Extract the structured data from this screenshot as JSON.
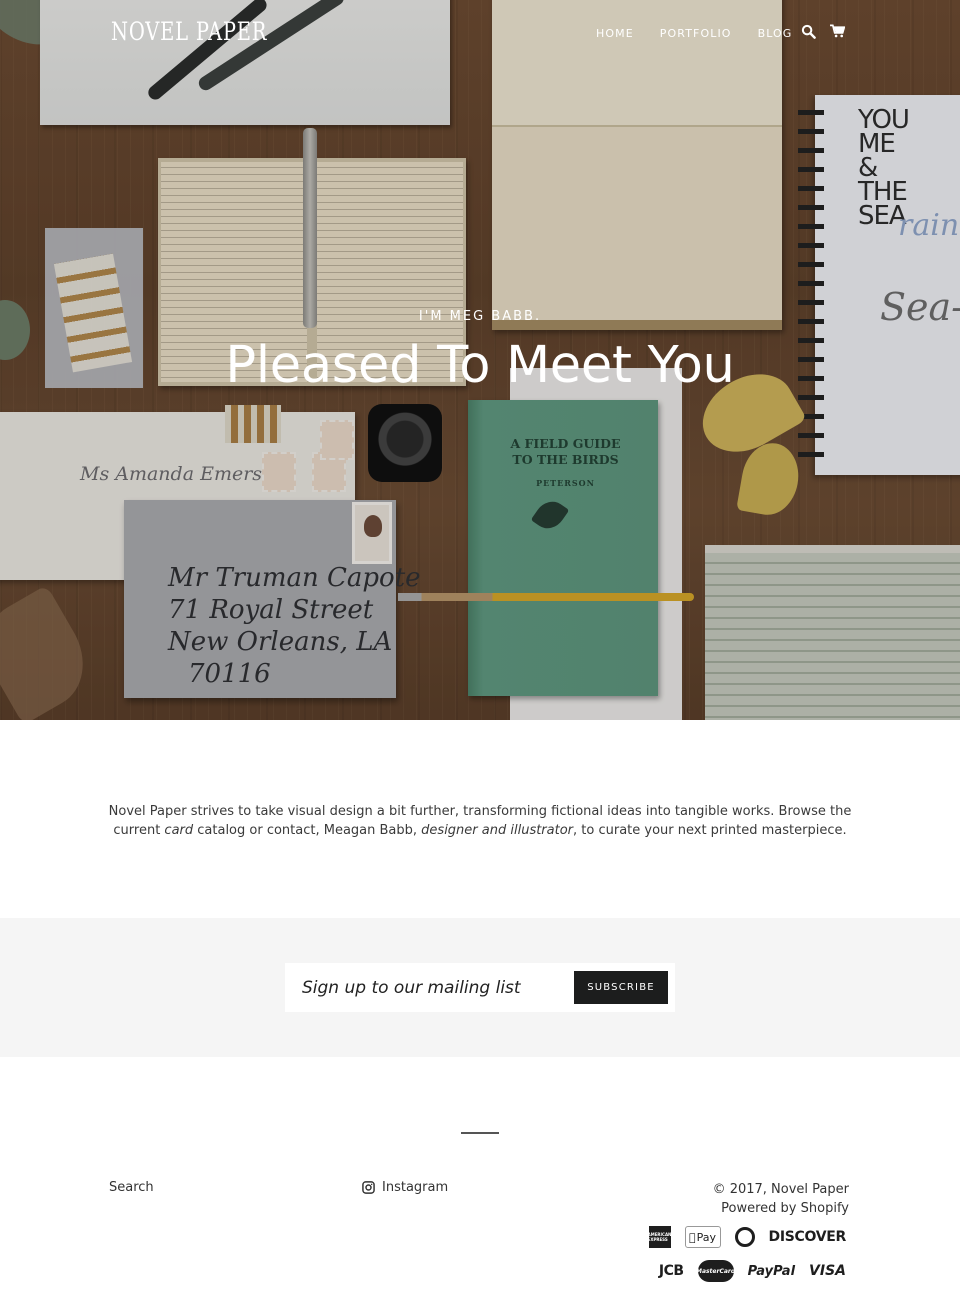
{
  "header": {
    "logo": "NOVEL PAPER",
    "nav": [
      {
        "label": "HOME"
      },
      {
        "label": "PORTFOLIO"
      },
      {
        "label": "BLOG"
      }
    ],
    "icons": [
      "search-icon",
      "cart-icon"
    ]
  },
  "hero": {
    "subtitle": "I'M MEG BABB.",
    "title": "Pleased To Meet You",
    "photo_text": {
      "notebook": "YOU ME & THE SEA",
      "notebook_rain": "rain",
      "notebook_sea": "Sea-",
      "envelope_back": "Ms Amanda Emerson",
      "envelope_front": [
        "Mr Truman Capote",
        "71 Royal Street",
        "New Orleans, LA",
        "70116"
      ],
      "book_title": "A FIELD GUIDE TO THE BIRDS",
      "book_author": "PETERSON"
    }
  },
  "intro": {
    "part1": "Novel Paper strives to take visual design a bit further, transforming fictional ideas into tangible works. Browse the current ",
    "em1": "card",
    "part2": " catalog or contact, Meagan Babb, ",
    "em2": "designer and illustrator",
    "part3": ", to curate your next printed masterpiece."
  },
  "newsletter": {
    "placeholder": "Sign up to our mailing list",
    "value": "",
    "button": "SUBSCRIBE"
  },
  "footer": {
    "search_link": "Search",
    "instagram_link": "Instagram",
    "copyright": "© 2017, Novel Paper",
    "powered": "Powered by Shopify",
    "payment_methods": [
      {
        "name": "American Express",
        "label": "AMERICAN EXPRESS"
      },
      {
        "name": "Apple Pay",
        "label": "Pay"
      },
      {
        "name": "Diners Club",
        "label": ""
      },
      {
        "name": "Discover",
        "label": "DISCOVER"
      },
      {
        "name": "JCB",
        "label": "JCB"
      },
      {
        "name": "Master",
        "label": "MasterCard"
      },
      {
        "name": "PayPal",
        "label": "PayPal"
      },
      {
        "name": "Visa",
        "label": "VISA"
      }
    ]
  }
}
